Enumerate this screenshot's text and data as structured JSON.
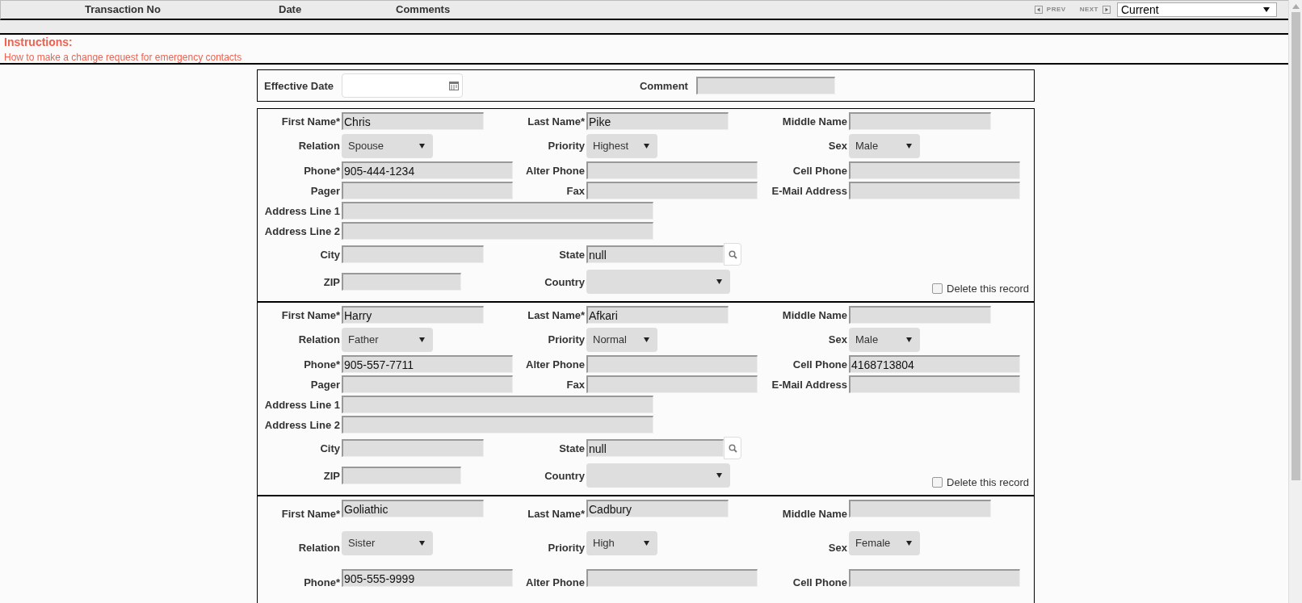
{
  "header": {
    "columns": [
      "Transaction No",
      "Date",
      "Comments"
    ],
    "prev": "PREV",
    "next": "NEXT",
    "version_select": "Current"
  },
  "instructions": {
    "title": "Instructions:",
    "link": "How to make a change request for emergency contacts"
  },
  "effective": {
    "date_label": "Effective Date",
    "comment_label": "Comment"
  },
  "contacts": [
    {
      "rows": [
        [
          {
            "kind": "text",
            "label": "First Name*",
            "value": "Chris"
          },
          {
            "kind": "text",
            "label": "Last Name*",
            "value": "Pike"
          },
          {
            "kind": "text",
            "label": "Middle Name"
          }
        ],
        [
          {
            "kind": "select",
            "label": "Relation",
            "value": "Spouse"
          },
          {
            "kind": "select",
            "label": "Priority",
            "value": "Highest"
          },
          {
            "kind": "select",
            "label": "Sex",
            "value": "Male"
          }
        ],
        [
          {
            "kind": "text",
            "label": "Phone*",
            "value": "905-444-1234"
          },
          {
            "kind": "text",
            "label": "Alter Phone"
          },
          {
            "kind": "text",
            "label": "Cell Phone"
          }
        ],
        [
          {
            "kind": "text",
            "label": "Pager"
          },
          {
            "kind": "text",
            "label": "Fax"
          },
          {
            "kind": "text",
            "label": "E-Mail Address"
          }
        ],
        [
          {
            "kind": "text",
            "label": "Address Line 1"
          }
        ],
        [
          {
            "kind": "text",
            "label": "Address Line 2"
          }
        ],
        [
          {
            "kind": "text",
            "label": "City"
          },
          {
            "kind": "lookup",
            "label": "State",
            "value": "null"
          }
        ],
        [
          {
            "kind": "text",
            "label": "ZIP"
          },
          {
            "kind": "select",
            "label": "Country"
          },
          {
            "kind": "checkbox",
            "label": "Delete this record",
            "checked": false
          }
        ]
      ]
    },
    {
      "rows": [
        [
          {
            "kind": "text",
            "label": "First Name*",
            "value": "Harry"
          },
          {
            "kind": "text",
            "label": "Last Name*",
            "value": "Afkari"
          },
          {
            "kind": "text",
            "label": "Middle Name"
          }
        ],
        [
          {
            "kind": "select",
            "label": "Relation",
            "value": "Father"
          },
          {
            "kind": "select",
            "label": "Priority",
            "value": "Normal"
          },
          {
            "kind": "select",
            "label": "Sex",
            "value": "Male"
          }
        ],
        [
          {
            "kind": "text",
            "label": "Phone*",
            "value": "905-557-7711"
          },
          {
            "kind": "text",
            "label": "Alter Phone"
          },
          {
            "kind": "text",
            "label": "Cell Phone",
            "value": "4168713804"
          }
        ],
        [
          {
            "kind": "text",
            "label": "Pager"
          },
          {
            "kind": "text",
            "label": "Fax"
          },
          {
            "kind": "text",
            "label": "E-Mail Address"
          }
        ],
        [
          {
            "kind": "text",
            "label": "Address Line 1"
          }
        ],
        [
          {
            "kind": "text",
            "label": "Address Line 2"
          }
        ],
        [
          {
            "kind": "text",
            "label": "City"
          },
          {
            "kind": "lookup",
            "label": "State",
            "value": "null"
          }
        ],
        [
          {
            "kind": "text",
            "label": "ZIP"
          },
          {
            "kind": "select",
            "label": "Country"
          },
          {
            "kind": "checkbox",
            "label": "Delete this record",
            "checked": false
          }
        ]
      ]
    },
    {
      "rows": [
        [
          {
            "kind": "text",
            "label": "First Name*",
            "value": "Goliathic"
          },
          {
            "kind": "text",
            "label": "Last Name*",
            "value": "Cadbury"
          },
          {
            "kind": "text",
            "label": "Middle Name"
          }
        ],
        [
          {
            "kind": "select",
            "label": "Relation",
            "value": "Sister"
          },
          {
            "kind": "select",
            "label": "Priority",
            "value": "High"
          },
          {
            "kind": "select",
            "label": "Sex",
            "value": "Female"
          }
        ],
        [
          {
            "kind": "text",
            "label": "Phone*",
            "value": "905-555-9999"
          },
          {
            "kind": "text",
            "label": "Alter Phone"
          },
          {
            "kind": "text",
            "label": "Cell Phone"
          }
        ]
      ]
    }
  ]
}
